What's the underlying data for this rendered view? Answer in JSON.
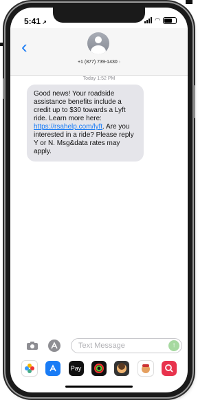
{
  "status_bar": {
    "time": "5:41"
  },
  "header": {
    "back_glyph": "‹",
    "contact_number": "+1 (877) 739-1430",
    "contact_chevron": "›"
  },
  "conversation": {
    "timestamp": "Today 1:52 PM",
    "message": {
      "text_before_link": "Good news! Your roadside assistance benefits include a credit up to $30 towards a Lyft ride. Learn more here: ",
      "link_text": "https://rsahelp.com/lyft",
      "text_after_link": ". Are you interested in a ride? Please reply Y or N. Msg&data rates may apply."
    }
  },
  "composer": {
    "placeholder": "Text Message",
    "send_glyph": "↑"
  },
  "app_tray": {
    "apple_pay_label": "Pay"
  },
  "colors": {
    "accent": "#1a7cf5",
    "bubble_gray": "#e5e5ea",
    "send_green": "#a6d9a0"
  }
}
